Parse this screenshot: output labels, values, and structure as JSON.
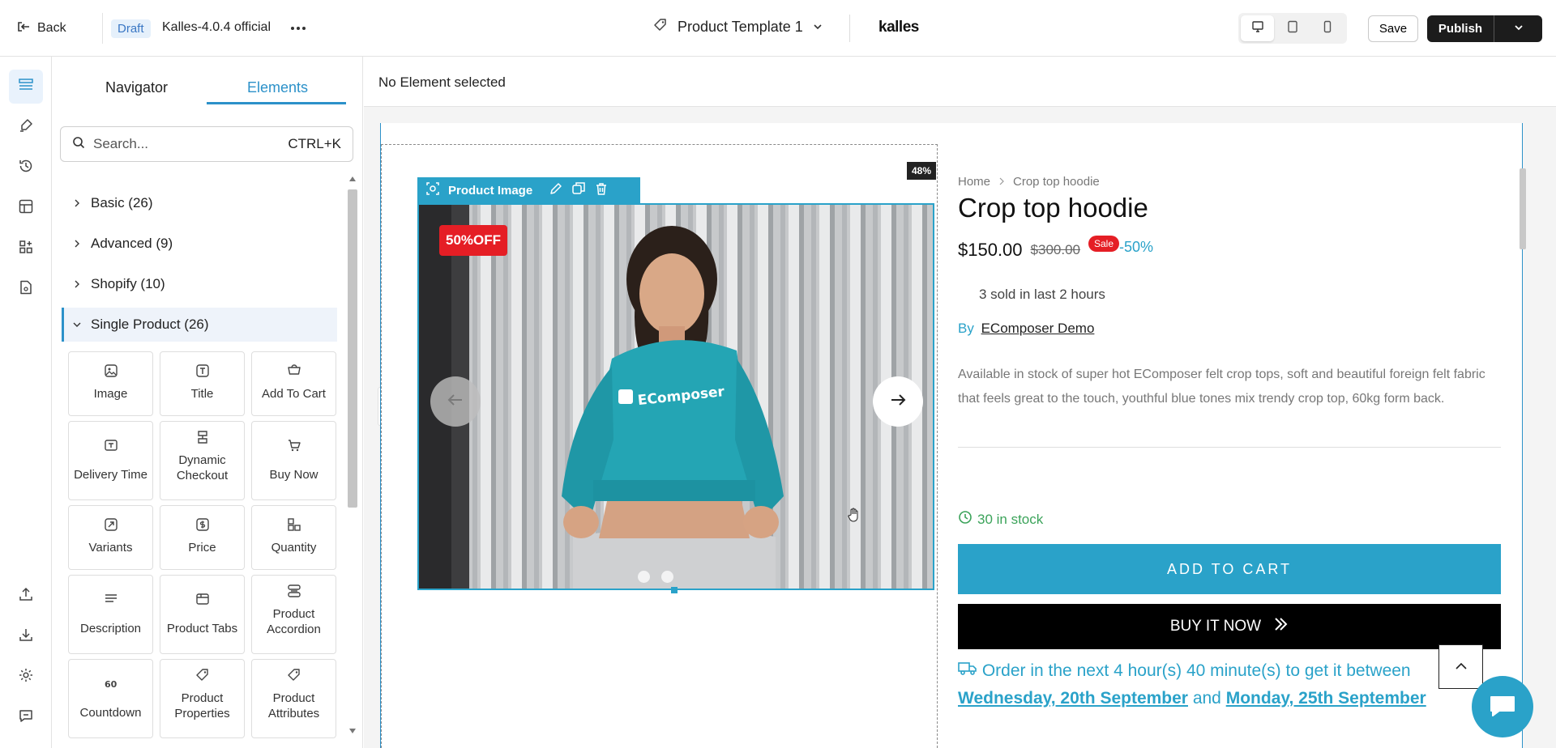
{
  "topbar": {
    "back_label": "Back",
    "draft_badge": "Draft",
    "theme_name": "Kalles-4.0.4 official",
    "template_name": "Product Template 1",
    "store_logo": "kalles",
    "save_label": "Save",
    "publish_label": "Publish",
    "devices": [
      "desktop-icon",
      "tablet-icon",
      "mobile-icon"
    ],
    "active_device": "desktop"
  },
  "rail": {
    "items": [
      "layout-icon",
      "brush-icon",
      "history-icon",
      "template-icon",
      "apps-icon",
      "pages-icon"
    ],
    "bottom_items": [
      "upload-icon",
      "download-icon",
      "settings-icon",
      "chat-icon"
    ]
  },
  "panel": {
    "tabs": [
      "Navigator",
      "Elements"
    ],
    "active_tab": "Elements",
    "search_placeholder": "Search...",
    "search_shortcut": "CTRL+K",
    "categories": [
      {
        "label": "Basic (26)",
        "open": false
      },
      {
        "label": "Advanced (9)",
        "open": false
      },
      {
        "label": "Shopify (10)",
        "open": false
      },
      {
        "label": "Single Product (26)",
        "open": true
      }
    ],
    "elements": [
      {
        "label": "Image",
        "icon": "image-icon"
      },
      {
        "label": "Title",
        "icon": "title-icon"
      },
      {
        "label": "Add To Cart",
        "icon": "cart-add-icon"
      },
      {
        "label": "Delivery Time",
        "icon": "delivery-time-icon"
      },
      {
        "label": "Dynamic Checkout",
        "icon": "dynamic-checkout-icon"
      },
      {
        "label": "Buy Now",
        "icon": "buy-now-icon"
      },
      {
        "label": "Variants",
        "icon": "variants-icon"
      },
      {
        "label": "Price",
        "icon": "price-icon"
      },
      {
        "label": "Quantity",
        "icon": "quantity-icon"
      },
      {
        "label": "Description",
        "icon": "description-icon"
      },
      {
        "label": "Product Tabs",
        "icon": "product-tabs-icon"
      },
      {
        "label": "Product Accordion",
        "icon": "product-accordion-icon"
      },
      {
        "label": "Countdown",
        "icon": "countdown-icon"
      },
      {
        "label": "Product Properties",
        "icon": "product-properties-icon"
      },
      {
        "label": "Product Attributes",
        "icon": "product-attributes-icon"
      }
    ]
  },
  "canvas": {
    "status": "No Element selected",
    "image_toolbar_label": "Product Image",
    "width_badge": "48%",
    "discount_badge": "50%OFF",
    "hoodie_brand": "EComposer",
    "slide_count": 2,
    "product": {
      "breadcrumb_home": "Home",
      "breadcrumb_current": "Crop top hoodie",
      "title": "Crop top hoodie",
      "price": "$150.00",
      "compare_price": "$300.00",
      "sale_badge": "Sale",
      "discount_pct": "-50%",
      "sold_text": "3 sold in last 2 hours",
      "by_label": "By",
      "vendor": "EComposer Demo",
      "description": "Available in stock of super hot EComposer felt crop tops, soft and beautiful foreign felt fabric that feels great to the touch, youthful blue tones mix trendy crop top, 60kg form back.",
      "stock_text": "30 in stock",
      "add_to_cart": "ADD TO CART",
      "buy_now": "BUY IT NOW",
      "order_prefix": "Order in the next 4 hour(s) 40 minute(s) to get it between",
      "order_date_from": "Wednesday, 20th September",
      "order_and": "and",
      "order_date_to": "Monday, 25th September"
    }
  },
  "colors": {
    "accent": "#2aa2c9",
    "tab_active": "#2c91c9",
    "sale_red": "#e51e25",
    "stock_green": "#3ba35a",
    "publish_bg": "#1c1c1c"
  }
}
